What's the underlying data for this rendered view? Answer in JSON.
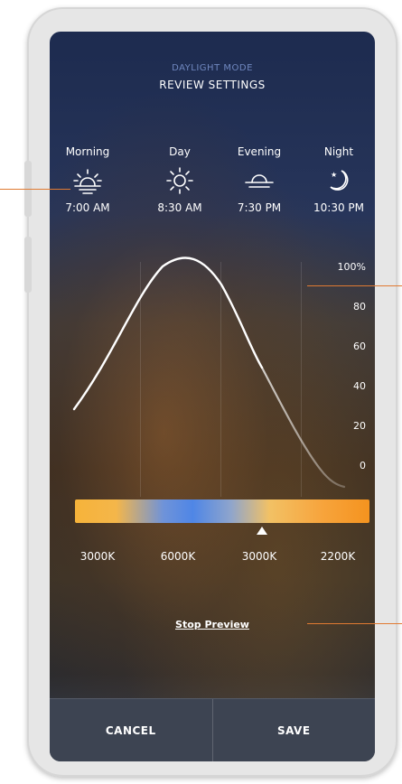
{
  "header": {
    "mode_label": "DAYLIGHT MODE",
    "title": "REVIEW SETTINGS"
  },
  "periods": [
    {
      "label": "Morning",
      "time": "7:00 AM",
      "icon": "sunrise-icon"
    },
    {
      "label": "Day",
      "time": "8:30 AM",
      "icon": "sun-icon"
    },
    {
      "label": "Evening",
      "time": "7:30 PM",
      "icon": "sunset-icon"
    },
    {
      "label": "Night",
      "time": "10:30 PM",
      "icon": "moon-icon"
    }
  ],
  "brightness_axis": {
    "ticks": [
      "100%",
      "80",
      "60",
      "40",
      "20",
      "0"
    ]
  },
  "color_temperature": {
    "labels": [
      "3000K",
      "6000K",
      "3000K",
      "2200K"
    ],
    "marker_position": 0.62
  },
  "actions": {
    "stop_preview": "Stop Preview",
    "cancel": "CANCEL",
    "save": "SAVE"
  },
  "colors": {
    "accent_callout": "#e07a32",
    "header_small": "#7088c0",
    "footer_bg": "#3d4452"
  }
}
